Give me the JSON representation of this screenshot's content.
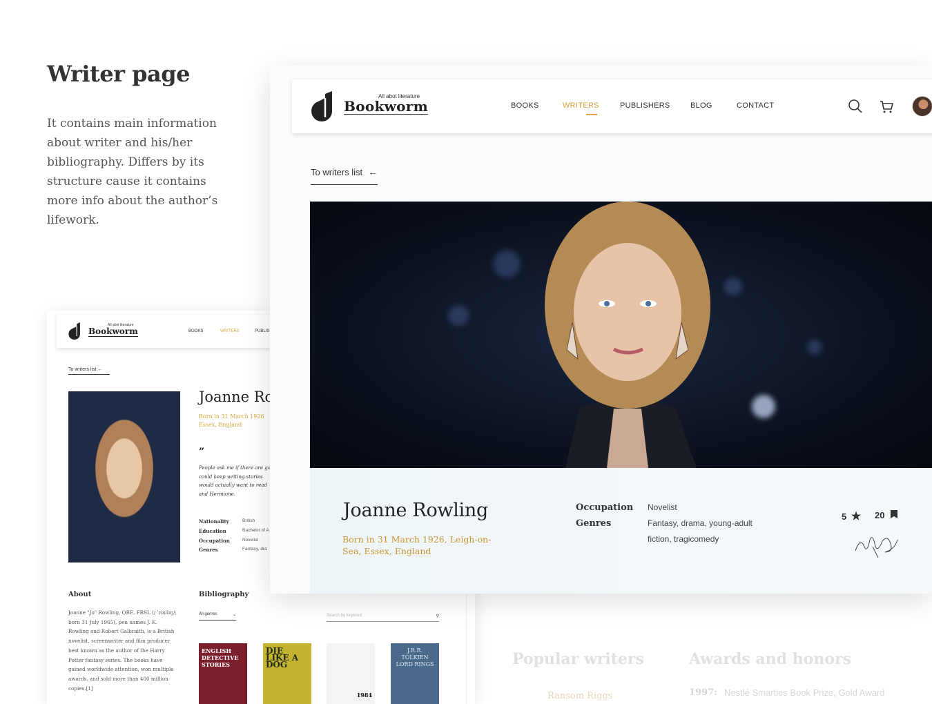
{
  "intro": {
    "heading": "Writer page",
    "description": "It contains main information about writer and his/her bibliography. Differs by its structure cause it contains more info about the author’s lifework."
  },
  "brand": {
    "tagline": "All abot literature",
    "name": "Bookworm",
    "accent_color": "#d9a53a"
  },
  "nav": {
    "items": [
      "BOOKS",
      "WRITERS",
      "PUBLISHERS",
      "BLOG",
      "CONTACT"
    ],
    "active": "WRITERS",
    "icons": [
      "search-icon",
      "cart-icon",
      "avatar"
    ]
  },
  "back_link": "To writers list",
  "writer": {
    "name": "Joanne Rowling",
    "born": "Born in 31 March 1926, Leigh-on-Sea, Essex, England",
    "occupation_label": "Occupation",
    "occupation": "Novelist",
    "genres_label": "Genres",
    "genres": "Fantasy, drama, young-adult fiction, tragicomedy",
    "rating": "5",
    "books_count": "20"
  },
  "mini": {
    "tagline": "All abot literature",
    "brand": "Bookworm",
    "nav": [
      "BOOKS",
      "WRITERS",
      "PUBLIS"
    ],
    "back": "To writers list",
    "name": "Joanne Ro",
    "born": "Born in 31 March 1926 Essex, England",
    "quote_mark": "”",
    "quote": "People ask me if there are go I could keep writing stories would actually want to read and Hermione.",
    "info": [
      {
        "label": "Nationality",
        "value": "British"
      },
      {
        "label": "Education",
        "value": "Bachelor of A"
      },
      {
        "label": "Occupation",
        "value": "Novelist"
      },
      {
        "label": "Genres",
        "value": "Fantasy, dra"
      }
    ],
    "about_title": "About",
    "about_text": "Joanne \"Jo\" Rowling, OBE, FRSL (/ ˈroʊlɪŋ/; born 31 July 1965), pen names J. K. Rowling and Robert Galbraith, is a British novelist, screenwriter and film producer best known as the author of the Harry Potter fantasy series. The books have gained worldwide attention, won multiple awards, and sold more than 400 million copies.[1]",
    "biblio_title": "Bibliography",
    "genres_select": "All genres",
    "search_placeholder": "Search by keyword",
    "books": [
      "ENGLISH DETECTIVE STORIES",
      "DIE LIKE A DOG",
      "1984",
      "J.R.R. TOLKIEN LORD RINGS"
    ]
  },
  "faded": {
    "popular_title": "Popular writers",
    "popular_first": "Ransom Riggs",
    "awards_title": "Awards and honors",
    "award_year": "1997:",
    "award_text": "Nestlé Smarties Book Prize, Gold Award"
  }
}
